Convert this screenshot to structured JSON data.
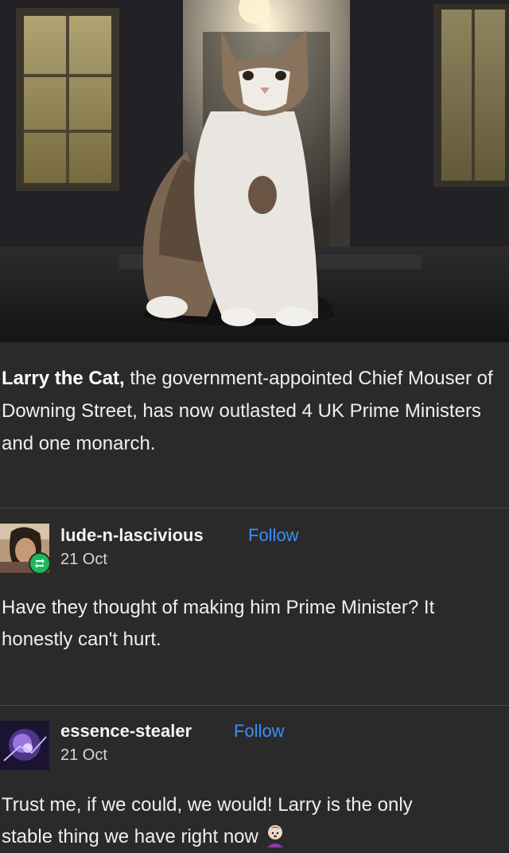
{
  "post": {
    "image": {
      "subject": "cat-photo",
      "icon": "cat-photo"
    },
    "caption_bold": "Larry the Cat,",
    "caption_rest": " the government-appointed Chief Mouser of Downing Street, has now outlasted 4 UK Prime Ministers and one monarch."
  },
  "replies": [
    {
      "username": "lude-n-lascivious",
      "follow_label": "Follow",
      "date": "21 Oct",
      "text": "Have they thought of making him Prime Minister? It honestly can't hurt.",
      "badge_icon": "reblog-icon"
    },
    {
      "username": "essence-stealer",
      "follow_label": "Follow",
      "date": "21 Oct",
      "text_line1": "Trust me, if we could, we would! Larry is the only",
      "text_line2": "stable thing we have right now"
    }
  ],
  "colors": {
    "background": "#2a2a2a",
    "follow_link": "#3d8ff5",
    "reblog_badge": "#1eb85c"
  }
}
